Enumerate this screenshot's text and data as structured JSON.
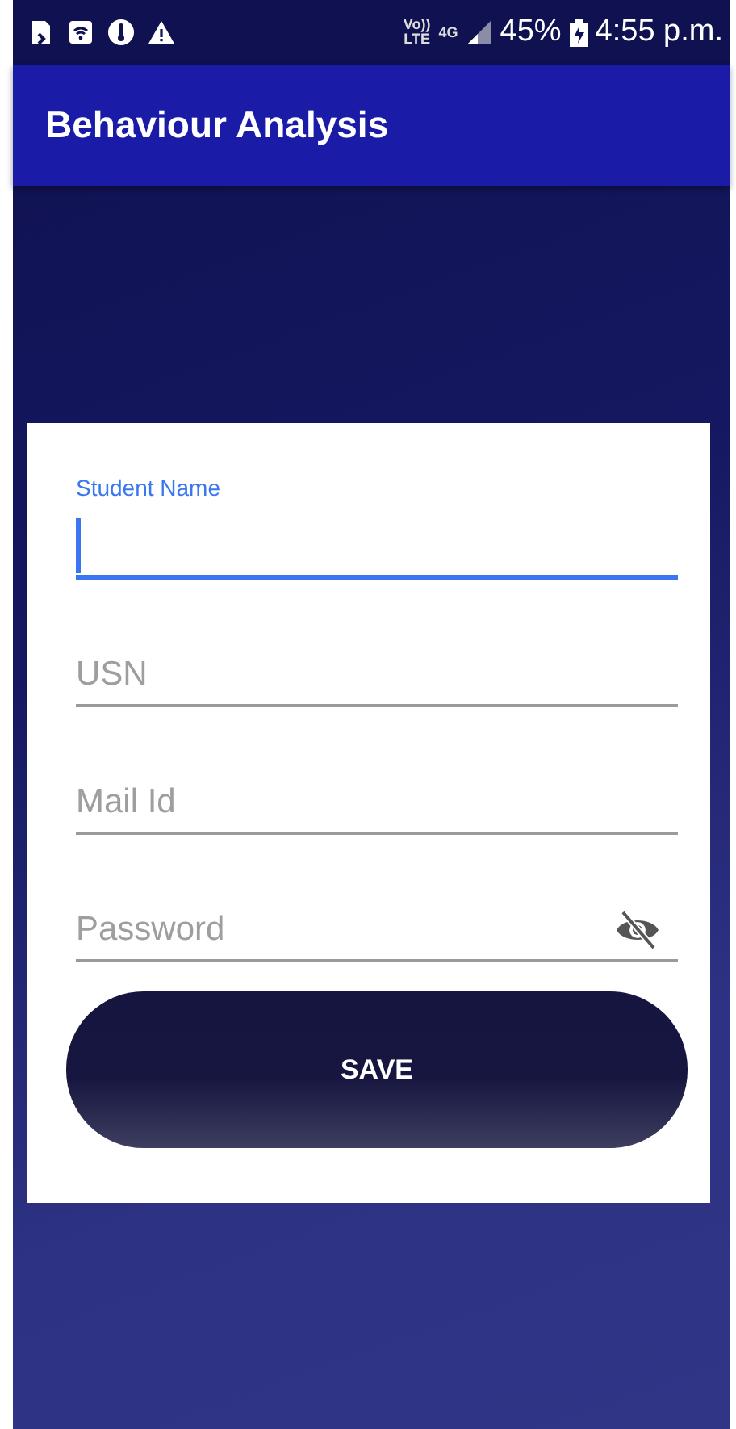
{
  "status_bar": {
    "volte_top": "Vo))",
    "volte_bottom": "LTE",
    "network": "4G",
    "battery": "45%",
    "time": "4:55 p.m."
  },
  "app_bar": {
    "title": "Behaviour Analysis"
  },
  "form": {
    "fields": [
      {
        "kind": "text",
        "label": "Student Name",
        "focused": true
      },
      {
        "kind": "text",
        "label": "USN",
        "focused": false
      },
      {
        "kind": "text",
        "label": "Mail Id",
        "focused": false
      },
      {
        "kind": "password",
        "label": "Password",
        "focused": false
      }
    ],
    "save_button": "SAVE"
  }
}
